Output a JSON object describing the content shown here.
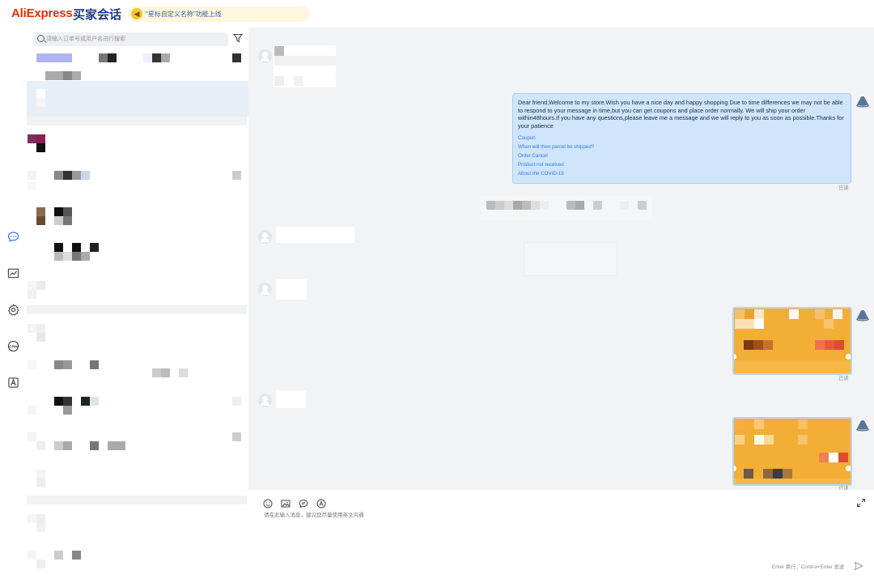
{
  "header": {
    "brand": "AliExpress",
    "title": "买家会话",
    "notice": "\"星标自定义名称\"功能上线"
  },
  "rail": {
    "items": [
      {
        "icon": "chat-icon",
        "active": true
      },
      {
        "icon": "analytics-icon"
      },
      {
        "icon": "settings-icon"
      },
      {
        "icon": "crm-icon",
        "label": "CRM"
      },
      {
        "icon": "translate-icon",
        "label": "A"
      }
    ]
  },
  "search": {
    "placeholder": "请输入订单号或用户名进行搜索"
  },
  "chat": {
    "welcome_message": "Dear friend,Welcome to my store.Wish you have a nice day and happy shopping.Due to time differences we may not be able to respond to your message in time,but you can get coupons and place order  normally. We will ship your order within48hours.If you have any questions,please leave me a message and we will reply to you as soon as possible.Thanks for your patience",
    "quick_links": [
      "Coupon",
      "When will then parcel be shipped?",
      "Order Cancel",
      "Product not received",
      "About the COVID-19"
    ],
    "read_label": "已读"
  },
  "composer": {
    "placeholder": "请在此输入消息，建议您尽量使用英文沟通",
    "hint": "Enter 换行，Control+Enter 发送"
  },
  "colors": {
    "brand_red": "#e62e04",
    "brand_blue": "#1f3c88",
    "bubble_blue": "#cfe5fb",
    "link_blue": "#2f7be0"
  }
}
